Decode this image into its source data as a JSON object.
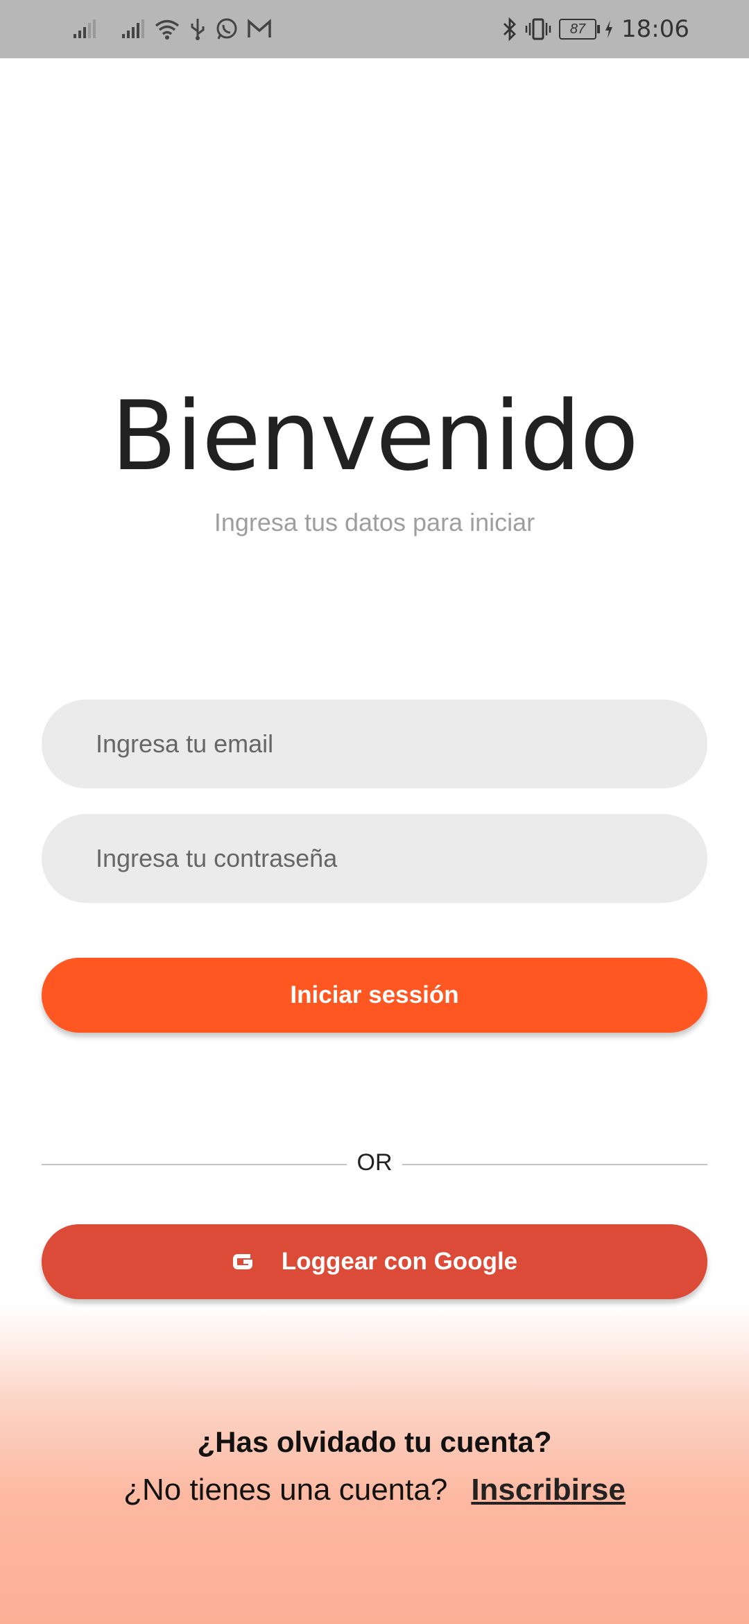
{
  "status_bar": {
    "time": "18:06",
    "battery": "87",
    "left_icons": [
      "signal-icon",
      "signal-icon",
      "wifi-icon",
      "usb-icon",
      "whatsapp-icon",
      "gmail-icon"
    ],
    "right_icons": [
      "bluetooth-icon",
      "vibrate-icon",
      "battery-icon",
      "charging-icon"
    ]
  },
  "header": {
    "title": "Bienvenido",
    "subtitle": "Ingresa tus datos para iniciar"
  },
  "form": {
    "email_placeholder": "Ingresa tu email",
    "email_value": "",
    "password_placeholder": "Ingresa tu contraseña",
    "password_value": "",
    "login_label": "Iniciar sessión"
  },
  "divider": {
    "label": "OR"
  },
  "google": {
    "label": "Loggear con Google",
    "icon": "google-icon"
  },
  "footer": {
    "forgot_label": "¿Has olvidado tu cuenta?",
    "no_account_text": "¿No tienes una cuenta?",
    "signup_link": "Inscribirse"
  },
  "colors": {
    "primary": "#ff5722",
    "google": "#dc4a38",
    "field_bg": "#ebebeb",
    "status_bar": "#b7b7b7"
  }
}
